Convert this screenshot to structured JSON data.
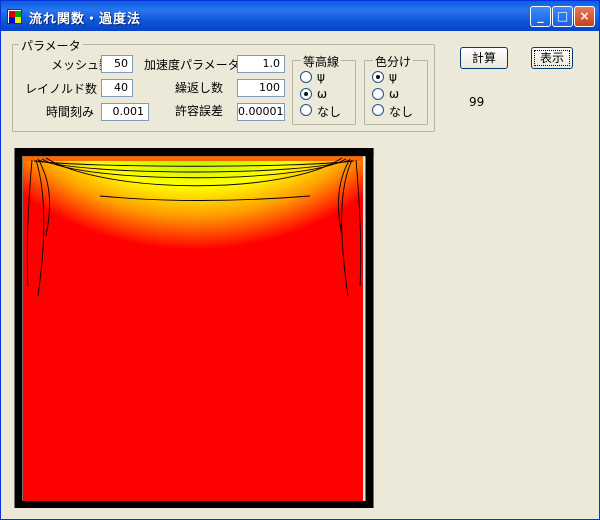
{
  "window": {
    "title": "流れ関数・過度法",
    "controls": {
      "minimize": "_",
      "maximize": "□",
      "close": "×"
    }
  },
  "params": {
    "legend": "パラメータ",
    "mesh_label": "メッシュ数",
    "mesh_value": "50",
    "reynolds_label": "レイノルド数",
    "reynolds_value": "40",
    "timestep_label": "時間刻み",
    "timestep_value": "0.001",
    "accel_label": "加速度パラメータ",
    "accel_value": "1.0",
    "iter_label": "繰返し数",
    "iter_value": "100",
    "tol_label": "許容誤差",
    "tol_value": "0.00001"
  },
  "contour": {
    "legend": "等高線",
    "options": [
      "ψ",
      "ω",
      "なし"
    ],
    "selected": 1
  },
  "coloring": {
    "legend": "色分け",
    "options": [
      "ψ",
      "ω",
      "なし"
    ],
    "selected": 0
  },
  "buttons": {
    "calc": "計算",
    "show": "表示"
  },
  "iteration_count": "99",
  "colors": {
    "frame": "#000000",
    "lid": "#9fc6e0",
    "background": "#ece9d8"
  }
}
